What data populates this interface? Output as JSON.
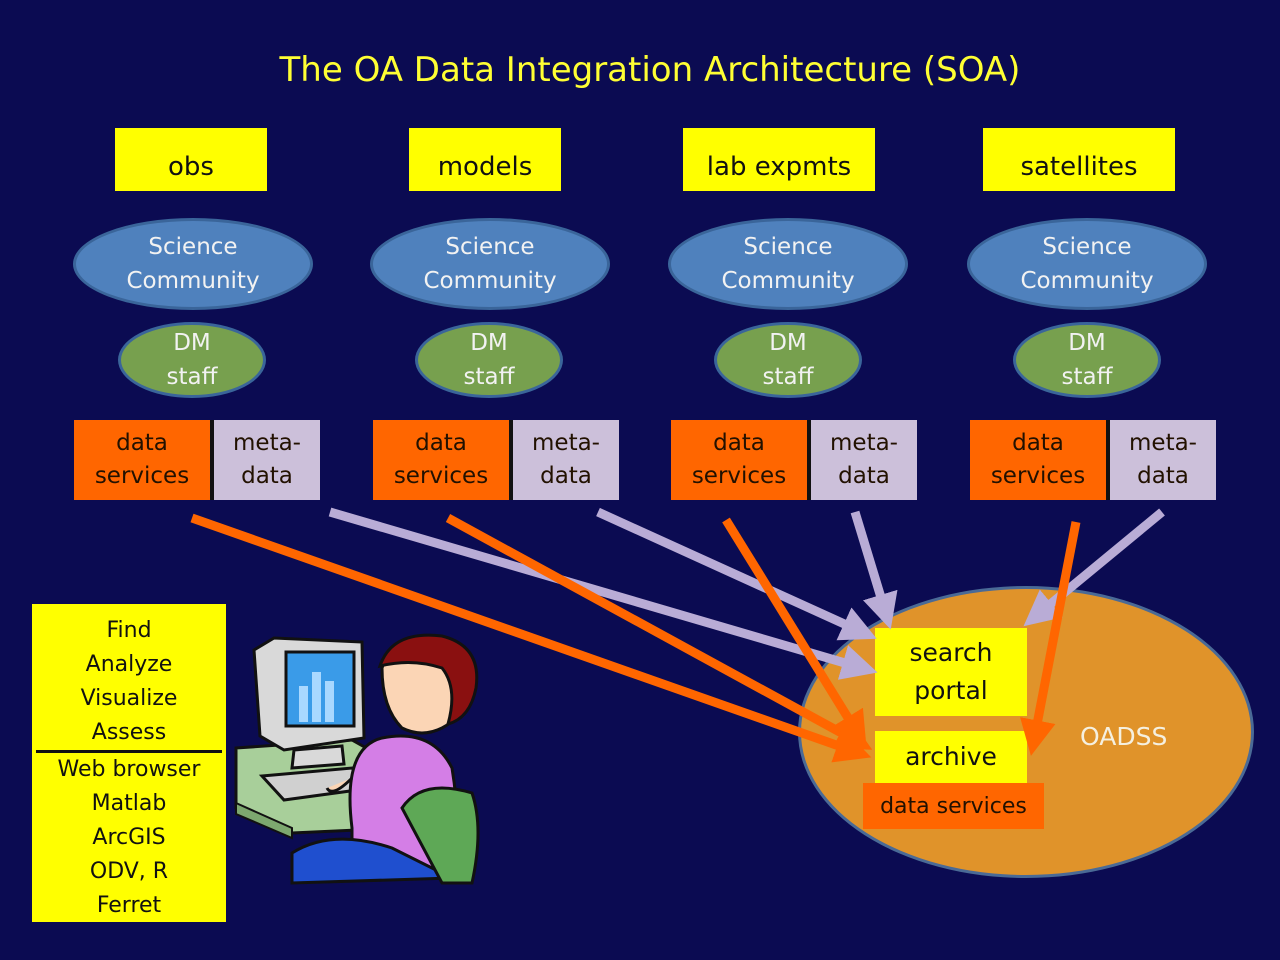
{
  "title": "The OA Data Integration Architecture (SOA)",
  "sources": [
    {
      "label": "obs",
      "community": [
        "Science",
        "Community"
      ],
      "staff": [
        "DM",
        "staff"
      ],
      "services": [
        "data",
        "services"
      ],
      "metadata": [
        "meta-",
        "data"
      ]
    },
    {
      "label": "models",
      "community": [
        "Science",
        "Community"
      ],
      "staff": [
        "DM",
        "staff"
      ],
      "services": [
        "data",
        "services"
      ],
      "metadata": [
        "meta-",
        "data"
      ]
    },
    {
      "label": "lab expmts",
      "community": [
        "Science",
        "Community"
      ],
      "staff": [
        "DM",
        "staff"
      ],
      "services": [
        "data",
        "services"
      ],
      "metadata": [
        "meta-",
        "data"
      ]
    },
    {
      "label": "satellites",
      "community": [
        "Science",
        "Community"
      ],
      "staff": [
        "DM",
        "staff"
      ],
      "services": [
        "data",
        "services"
      ],
      "metadata": [
        "meta-",
        "data"
      ]
    }
  ],
  "toolbox": {
    "actions": [
      "Find",
      "Analyze",
      "Visualize",
      "Assess"
    ],
    "tools": [
      "Web browser",
      "Matlab",
      "ArcGIS",
      "ODV, R",
      "Ferret"
    ]
  },
  "oadss": {
    "label": "OADSS",
    "search_portal": [
      "search",
      "portal"
    ],
    "archive": "archive",
    "data_services": "data services"
  },
  "illustration": "user-at-computer",
  "colors": {
    "background": "#0b0b52",
    "title": "#ffff33",
    "source_box": "#ffff00",
    "community": "#4f81bd",
    "dm_staff": "#77a04e",
    "data_services": "#ff6600",
    "metadata": "#ccc0da",
    "oadss": "#e0932a",
    "data_arrow": "#ff6600",
    "metadata_arrow": "#b9acd6"
  }
}
